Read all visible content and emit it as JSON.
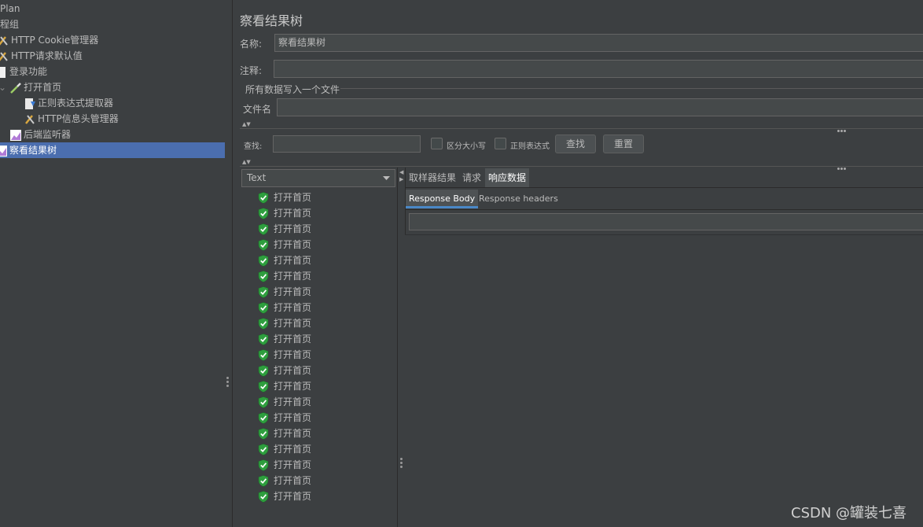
{
  "tree": {
    "items": [
      {
        "label": "Plan",
        "icon": "test-plan-icon"
      },
      {
        "label": "程组",
        "icon": "thread-group-icon"
      },
      {
        "label": "HTTP Cookie管理器",
        "icon": "config-tool-icon"
      },
      {
        "label": "HTTP请求默认值",
        "icon": "config-tool-icon"
      },
      {
        "label": "登录功能",
        "icon": "page-icon"
      },
      {
        "label": "打开首页",
        "icon": "sampler-pipette-icon"
      },
      {
        "label": "正则表达式提取器",
        "icon": "extractor-icon"
      },
      {
        "label": "HTTP信息头管理器",
        "icon": "config-tool-icon"
      },
      {
        "label": "后端监听器",
        "icon": "listener-chart-icon"
      },
      {
        "label": "察看结果树",
        "icon": "listener-chart-icon"
      }
    ]
  },
  "panel": {
    "title": "察看结果树",
    "name_label": "名称:",
    "name_value": "察看结果树",
    "comment_label": "注释:",
    "comment_value": "",
    "file_group_label": "所有数据写入一个文件",
    "filename_label": "文件名",
    "filename_value": ""
  },
  "search": {
    "label": "查找:",
    "value": "",
    "case_label": "区分大小写",
    "regex_label": "正则表达式",
    "find_button": "查找",
    "reset_button": "重置"
  },
  "results": {
    "renderer": "Text",
    "rows": [
      "打开首页",
      "打开首页",
      "打开首页",
      "打开首页",
      "打开首页",
      "打开首页",
      "打开首页",
      "打开首页",
      "打开首页",
      "打开首页",
      "打开首页",
      "打开首页",
      "打开首页",
      "打开首页",
      "打开首页",
      "打开首页",
      "打开首页",
      "打开首页",
      "打开首页",
      "打开首页"
    ]
  },
  "detail": {
    "tabs": [
      "取样器结果",
      "请求",
      "响应数据"
    ],
    "active_tab": 2,
    "subtabs": [
      "Response Body",
      "Response headers"
    ],
    "active_subtab": 0
  },
  "watermark": "CSDN @罐装七喜",
  "colors": {
    "selection": "#4b6eaf",
    "success": "#3cb043"
  }
}
